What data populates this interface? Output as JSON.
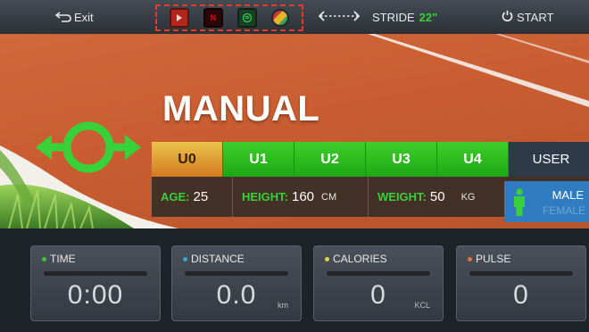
{
  "topbar": {
    "exit_label": "Exit",
    "apps": [
      "youtube-app",
      "netflix-app",
      "spotify-app",
      "chrome-app"
    ],
    "stride_label": "STRIDE",
    "stride_value": "22\"",
    "start_label": "START"
  },
  "mode": {
    "title": "MANUAL"
  },
  "users": {
    "items": [
      "U0",
      "U1",
      "U2",
      "U3",
      "U4"
    ],
    "user_label": "USER"
  },
  "profile": {
    "age_label": "AGE:",
    "age_value": "25",
    "height_label": "HEIGHT:",
    "height_value": "160",
    "height_unit": "CM",
    "weight_label": "WEIGHT:",
    "weight_value": "50",
    "weight_unit": "KG",
    "gender_male": "MALE",
    "gender_female": "FEMALE"
  },
  "panels": [
    {
      "label": "TIME",
      "value": "0:00",
      "unit": "",
      "dot": "#3cc13c"
    },
    {
      "label": "DISTANCE",
      "value": "0.0",
      "unit": "km",
      "dot": "#3aa6d8"
    },
    {
      "label": "CALORIES",
      "value": "0",
      "unit": "KCL",
      "dot": "#e8d13a"
    },
    {
      "label": "PULSE",
      "value": "0",
      "unit": "",
      "dot": "#e8703a"
    }
  ],
  "colors": {
    "accent_green": "#39d139",
    "selected_user": "#e39a32",
    "gender_blue": "#2f7dc0"
  }
}
